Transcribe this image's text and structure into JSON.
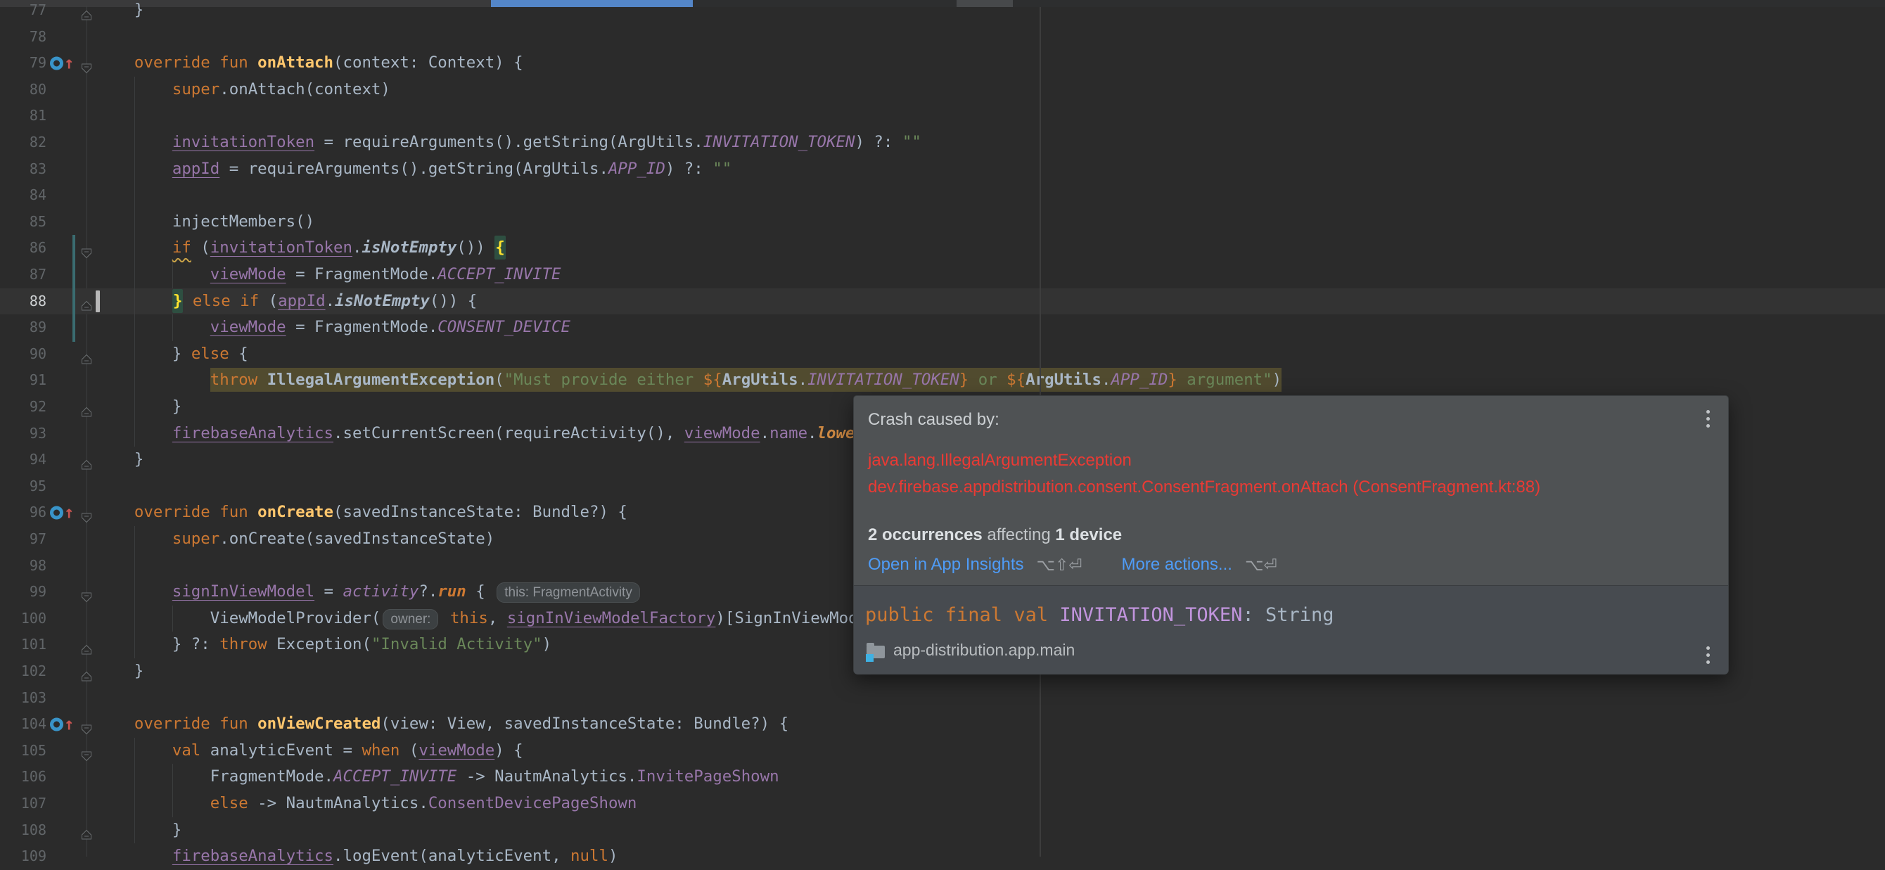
{
  "chrome": {
    "tab_underline_color": "#5486c8"
  },
  "editor": {
    "file_language": "kotlin",
    "current_line": 88,
    "lines": [
      {
        "n": "77",
        "fold": "end",
        "tok": [
          [
            "d",
            "    }"
          ]
        ]
      },
      {
        "n": "78",
        "tok": []
      },
      {
        "n": "79",
        "fold": "start",
        "ov": true,
        "tok": [
          [
            "k",
            "    override fun "
          ],
          [
            "fnd",
            "onAttach"
          ],
          [
            "d",
            "(context: Context) {"
          ]
        ]
      },
      {
        "n": "80",
        "tok": [
          [
            "d",
            "        "
          ],
          [
            "k",
            "super"
          ],
          [
            "d",
            ".onAttach(context)"
          ]
        ]
      },
      {
        "n": "81",
        "tok": []
      },
      {
        "n": "82",
        "tok": [
          [
            "d",
            "        "
          ],
          [
            "f",
            "invitationToken"
          ],
          [
            "d",
            " = requireArguments().getString(ArgUtils."
          ],
          [
            "c",
            "INVITATION_TOKEN"
          ],
          [
            "d",
            ") ?: "
          ],
          [
            "s",
            "\"\""
          ]
        ]
      },
      {
        "n": "83",
        "tok": [
          [
            "d",
            "        "
          ],
          [
            "f",
            "appId"
          ],
          [
            "d",
            " = requireArguments().getString(ArgUtils."
          ],
          [
            "c",
            "APP_ID"
          ],
          [
            "d",
            ") ?: "
          ],
          [
            "s",
            "\"\""
          ]
        ]
      },
      {
        "n": "84",
        "tok": []
      },
      {
        "n": "85",
        "tok": [
          [
            "d",
            "        injectMembers()"
          ]
        ]
      },
      {
        "n": "86",
        "fold": "start",
        "tok": [
          [
            "d",
            "        "
          ],
          [
            "kw",
            "if"
          ],
          [
            "d",
            " ("
          ],
          [
            "f",
            "invitationToken"
          ],
          [
            "d",
            "."
          ],
          [
            "dbi",
            "isNotEmpty"
          ],
          [
            "d",
            "()) "
          ],
          [
            "yb",
            "{"
          ]
        ]
      },
      {
        "n": "87",
        "tok": [
          [
            "d",
            "            "
          ],
          [
            "f",
            "viewMode"
          ],
          [
            "d",
            " = FragmentMode."
          ],
          [
            "c",
            "ACCEPT_INVITE"
          ]
        ]
      },
      {
        "n": "88",
        "cur": true,
        "fold": "end",
        "tok": [
          [
            "d",
            "        "
          ],
          [
            "yb",
            "}"
          ],
          [
            "d",
            " "
          ],
          [
            "k",
            "else"
          ],
          [
            "d",
            " "
          ],
          [
            "k",
            "if"
          ],
          [
            "d",
            " ("
          ],
          [
            "f",
            "appId"
          ],
          [
            "d",
            "."
          ],
          [
            "dbi",
            "isNotEmpty"
          ],
          [
            "d",
            "()) {"
          ]
        ]
      },
      {
        "n": "89",
        "tok": [
          [
            "d",
            "            "
          ],
          [
            "f",
            "viewMode"
          ],
          [
            "d",
            " = FragmentMode."
          ],
          [
            "c",
            "CONSENT_DEVICE"
          ]
        ]
      },
      {
        "n": "90",
        "fold": "end",
        "tok": [
          [
            "d",
            "        } "
          ],
          [
            "k",
            "else"
          ],
          [
            "d",
            " {"
          ]
        ]
      },
      {
        "n": "91",
        "tok": [
          [
            "d",
            "            "
          ],
          [
            "k hl",
            "throw"
          ],
          [
            "d hl",
            " "
          ],
          [
            "db hl",
            "IllegalArgumentException"
          ],
          [
            "d hl",
            "("
          ],
          [
            "s hl",
            "\"Must provide either "
          ],
          [
            "t hl",
            "${"
          ],
          [
            "db hl",
            "ArgUtils"
          ],
          [
            "d hl",
            "."
          ],
          [
            "c hl",
            "INVITATION_TOKEN"
          ],
          [
            "t hl",
            "}"
          ],
          [
            "s hl",
            " or "
          ],
          [
            "t hl",
            "${"
          ],
          [
            "db hl",
            "ArgUtils"
          ],
          [
            "d hl",
            "."
          ],
          [
            "c hl",
            "APP_ID"
          ],
          [
            "t hl",
            "}"
          ],
          [
            "s hl",
            " argument\""
          ],
          [
            "d hl",
            ")"
          ]
        ]
      },
      {
        "n": "92",
        "fold": "end",
        "tok": [
          [
            "d",
            "        }"
          ]
        ]
      },
      {
        "n": "93",
        "tok": [
          [
            "d",
            "        "
          ],
          [
            "f",
            "firebaseAnalytics"
          ],
          [
            "d",
            ".setCurrentScreen(requireActivity(), "
          ],
          [
            "f",
            "viewMode"
          ],
          [
            "d",
            "."
          ],
          [
            "p",
            "name"
          ],
          [
            "d",
            "."
          ],
          [
            "lo",
            "lowe"
          ]
        ]
      },
      {
        "n": "94",
        "fold": "end",
        "tok": [
          [
            "d",
            "    }"
          ]
        ]
      },
      {
        "n": "95",
        "tok": []
      },
      {
        "n": "96",
        "fold": "start",
        "ov": true,
        "tok": [
          [
            "k",
            "    override fun "
          ],
          [
            "fnd",
            "onCreate"
          ],
          [
            "d",
            "(savedInstanceState: Bundle?) {"
          ]
        ]
      },
      {
        "n": "97",
        "tok": [
          [
            "d",
            "        "
          ],
          [
            "k",
            "super"
          ],
          [
            "d",
            ".onCreate(savedInstanceState)"
          ]
        ]
      },
      {
        "n": "98",
        "tok": []
      },
      {
        "n": "99",
        "fold": "start",
        "tok": [
          [
            "d",
            "        "
          ],
          [
            "f",
            "signInViewModel"
          ],
          [
            "d",
            " = "
          ],
          [
            "pi",
            "activity"
          ],
          [
            "d",
            "?."
          ],
          [
            "ki",
            "run"
          ],
          [
            "d",
            " { "
          ],
          [
            "chip",
            "this: FragmentActivity"
          ]
        ]
      },
      {
        "n": "100",
        "tok": [
          [
            "d",
            "            ViewModelProvider("
          ],
          [
            "chip",
            "owner:"
          ],
          [
            "d",
            " "
          ],
          [
            "k",
            "this"
          ],
          [
            "d",
            ", "
          ],
          [
            "f",
            "signInViewModelFactory"
          ],
          [
            "d",
            ")[SignInViewMod"
          ]
        ]
      },
      {
        "n": "101",
        "fold": "end",
        "tok": [
          [
            "d",
            "        } ?: "
          ],
          [
            "k",
            "throw"
          ],
          [
            "d",
            " Exception("
          ],
          [
            "s",
            "\"Invalid Activity\""
          ],
          [
            "d",
            ")"
          ]
        ]
      },
      {
        "n": "102",
        "fold": "end",
        "tok": [
          [
            "d",
            "    }"
          ]
        ]
      },
      {
        "n": "103",
        "tok": []
      },
      {
        "n": "104",
        "fold": "start",
        "ov": true,
        "tok": [
          [
            "k",
            "    override fun "
          ],
          [
            "fnd",
            "onViewCreated"
          ],
          [
            "d",
            "(view: View, savedInstanceState: Bundle?) {"
          ]
        ]
      },
      {
        "n": "105",
        "fold": "start",
        "tok": [
          [
            "d",
            "        "
          ],
          [
            "k",
            "val"
          ],
          [
            "d",
            " analyticEvent = "
          ],
          [
            "k",
            "when"
          ],
          [
            "d",
            " ("
          ],
          [
            "f",
            "viewMode"
          ],
          [
            "d",
            ") {"
          ]
        ]
      },
      {
        "n": "106",
        "tok": [
          [
            "d",
            "            FragmentMode."
          ],
          [
            "c",
            "ACCEPT_INVITE"
          ],
          [
            "d",
            " -> NautmAnalytics."
          ],
          [
            "p",
            "InvitePageShown"
          ]
        ]
      },
      {
        "n": "107",
        "tok": [
          [
            "d",
            "            "
          ],
          [
            "k",
            "else"
          ],
          [
            "d",
            " -> NautmAnalytics."
          ],
          [
            "p",
            "ConsentDevicePageShown"
          ]
        ]
      },
      {
        "n": "108",
        "fold": "end",
        "tok": [
          [
            "d",
            "        }"
          ]
        ]
      },
      {
        "n": "109",
        "tok": [
          [
            "d",
            "        "
          ],
          [
            "f",
            "firebaseAnalytics"
          ],
          [
            "d",
            ".logEvent(analyticEvent, "
          ],
          [
            "k",
            "null"
          ],
          [
            "d",
            ")"
          ]
        ]
      }
    ]
  },
  "popup": {
    "crash": {
      "title": "Crash caused by:",
      "exception": "java.lang.IllegalArgumentException",
      "location": "dev.firebase.appdistribution.consent.ConsentFragment.onAttach (ConsentFragment.kt:88)",
      "occurrences_bold": "2 occurrences",
      "occurrences_mid": " affecting ",
      "devices_bold": "1 device",
      "link_insights": "Open in App Insights",
      "shortcut_insights": "⌥⇧⏎",
      "link_more": "More actions...",
      "shortcut_more": "⌥⏎"
    },
    "declaration": {
      "tokens": [
        [
          "pk",
          "public final val "
        ],
        [
          "pc",
          "INVITATION_TOKEN"
        ],
        [
          "pd",
          ": String"
        ]
      ],
      "module": "app-distribution.app.main"
    }
  }
}
